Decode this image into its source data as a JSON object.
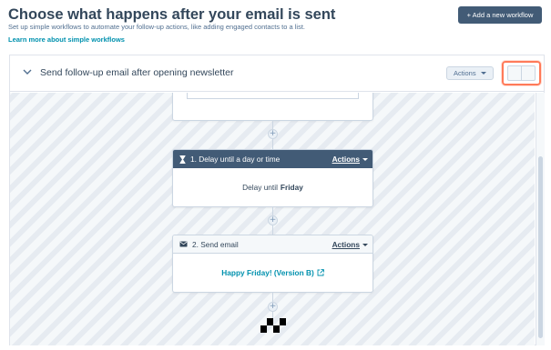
{
  "header": {
    "title": "Choose what happens after your email is sent",
    "subtitle": "Set up simple workflows to automate your follow-up actions, like adding engaged contacts to a list.",
    "learn_more": "Learn more about simple workflows",
    "add_workflow_label": "+ Add a new workflow"
  },
  "workflow": {
    "title": "Send follow-up email after opening newsletter",
    "actions_label": "Actions"
  },
  "steps": [
    {
      "title": "1. Delay until a day or time",
      "actions_label": "Actions",
      "body_prefix": "Delay until",
      "body_value": "Friday"
    },
    {
      "title": "2. Send email",
      "actions_label": "Actions",
      "email_name": "Happy Friday! (Version B)"
    }
  ],
  "plus_label": "+",
  "colors": {
    "primary_dark": "#425b76",
    "link": "#0091ae",
    "highlight": "#ff7a59"
  }
}
